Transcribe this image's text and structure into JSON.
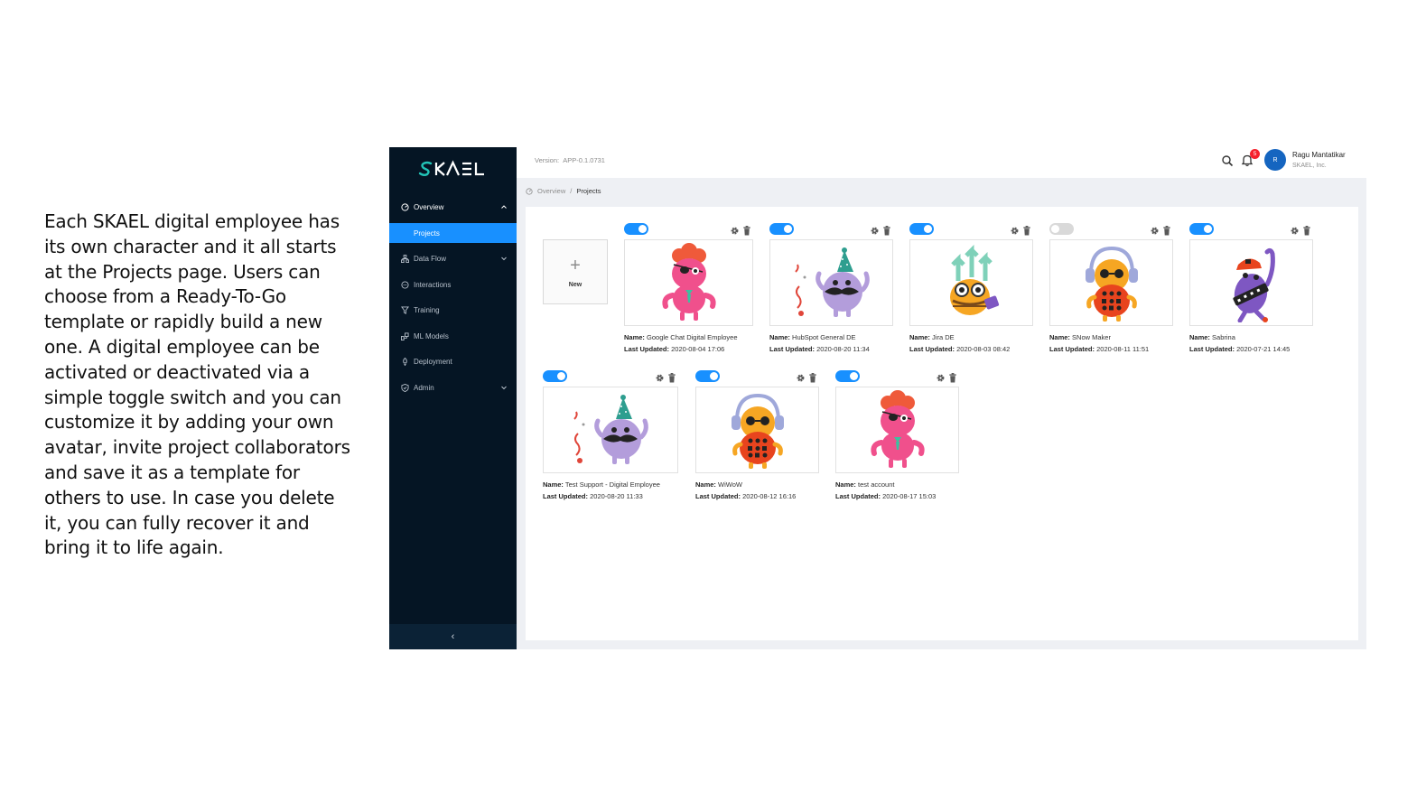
{
  "description": "Each SKAEL digital employee has its own character and it all starts at the Projects page. Users can choose from a Ready-To-Go template or rapidly build a new one. A digital employee can be activated or deactivated via a simple toggle switch and you can customize it by adding your own avatar, invite project collaborators and save it as a template for others to use. In case you delete it, you can fully recover it and bring it to life again.",
  "app": {
    "logo_text": "SKAEL",
    "version_label": "Version:",
    "version": "APP-0.1.0731",
    "notifications_count": "5",
    "user": {
      "initial": "R",
      "name": "Ragu Mantatikar",
      "org": "SKAEL, Inc."
    }
  },
  "sidebar": {
    "overview": "Overview",
    "projects": "Projects",
    "items": [
      {
        "label": "Data Flow",
        "icon": "data-flow-icon",
        "has_chevron": true
      },
      {
        "label": "Interactions",
        "icon": "interactions-icon",
        "has_chevron": false
      },
      {
        "label": "Training",
        "icon": "training-icon",
        "has_chevron": false
      },
      {
        "label": "ML Models",
        "icon": "ml-models-icon",
        "has_chevron": false
      },
      {
        "label": "Deployment",
        "icon": "deployment-icon",
        "has_chevron": false
      },
      {
        "label": "Admin",
        "icon": "admin-icon",
        "has_chevron": true
      }
    ],
    "collapse_glyph": "‹"
  },
  "breadcrumb": {
    "home": "Overview",
    "sep": "/",
    "current": "Projects"
  },
  "new_card": {
    "plus": "+",
    "label": "New"
  },
  "labels": {
    "name": "Name:",
    "last_updated": "Last Updated:"
  },
  "projects": [
    {
      "name": "Google Chat Digital Employee",
      "updated": "2020-08-04 17:06",
      "active": true,
      "character": "pink-pirate"
    },
    {
      "name": "HubSpot General DE",
      "updated": "2020-08-20 11:34",
      "active": true,
      "character": "purple-mustache"
    },
    {
      "name": "Jira DE",
      "updated": "2020-08-03 08:42",
      "active": true,
      "character": "orange-glasses"
    },
    {
      "name": "SNow Maker",
      "updated": "2020-08-11 11:51",
      "active": false,
      "character": "orange-headphones"
    },
    {
      "name": "Sabrina",
      "updated": "2020-07-21 14:45",
      "active": true,
      "character": "purple-cap"
    },
    {
      "name": "Test Support - Digital Employee",
      "updated": "2020-08-20 11:33",
      "active": true,
      "character": "purple-mustache"
    },
    {
      "name": "WiWoW",
      "updated": "2020-08-12 16:16",
      "active": true,
      "character": "orange-headphones"
    },
    {
      "name": "test account",
      "updated": "2020-08-17 15:03",
      "active": true,
      "character": "pink-pirate"
    }
  ],
  "colors": {
    "sidebar_bg": "#051524",
    "accent": "#1890ff",
    "logo_teal": "#22c3b6",
    "badge": "#f5222d"
  }
}
